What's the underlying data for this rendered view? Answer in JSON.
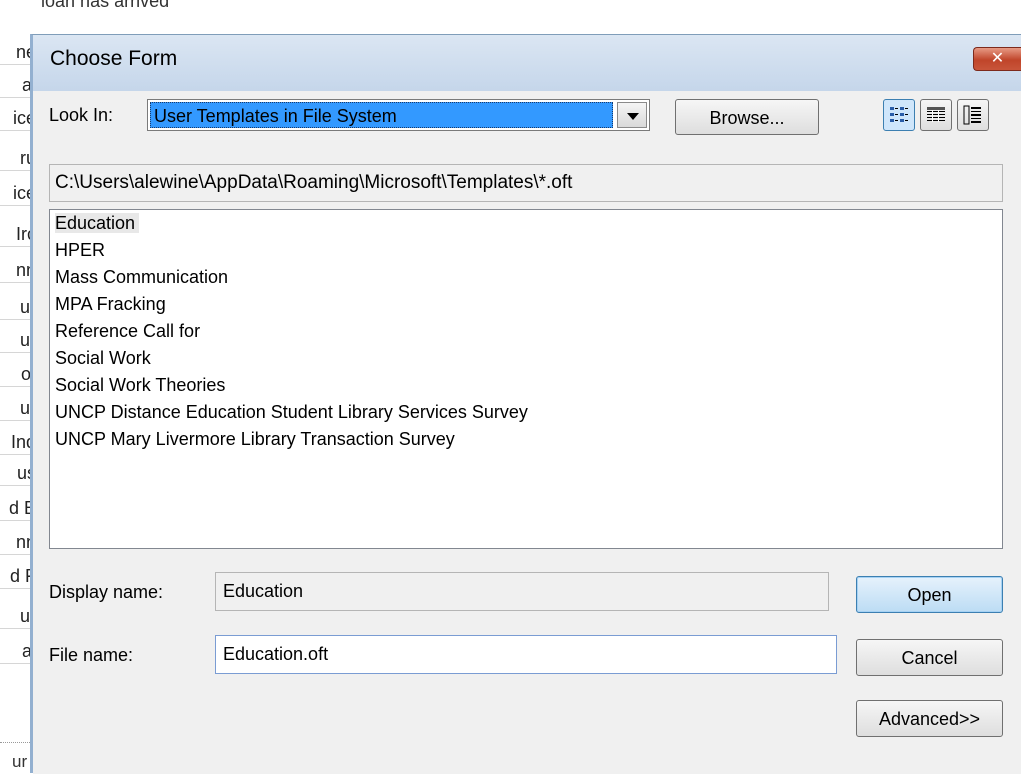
{
  "background": {
    "header_text": "sted loan has arrived",
    "rows": [
      "ne",
      "al",
      "ice",
      "ru",
      "ice",
      "Irc",
      "nn",
      "ur",
      "ur",
      "ot",
      "ur",
      "Ind",
      "us",
      "d E",
      "nn",
      "d F",
      "ur",
      "al"
    ],
    "bottom_text": "ur"
  },
  "dialog": {
    "title": "Choose Form",
    "close_label": "✕",
    "look_in_label": "Look In:",
    "look_in_value": "User Templates in File System",
    "browse_label": "Browse...",
    "view_buttons": [
      "list-view-icon",
      "details-view-icon",
      "properties-view-icon"
    ],
    "path": "C:\\Users\\alewine\\AppData\\Roaming\\Microsoft\\Templates\\*.oft",
    "forms": [
      "Education",
      "HPER",
      "Mass Communication",
      "MPA Fracking",
      "Reference Call for",
      "Social Work",
      "Social Work Theories",
      "UNCP Distance Education Student Library Services Survey",
      "UNCP Mary Livermore Library Transaction Survey"
    ],
    "selected_form": "Education",
    "display_name_label": "Display name:",
    "display_name_value": "Education",
    "file_name_label": "File name:",
    "file_name_value": "Education.oft",
    "open_label": "Open",
    "cancel_label": "Cancel",
    "advanced_label": "Advanced>>"
  },
  "colors": {
    "title_bar": "#c5d6ea",
    "close_button": "#c0452a",
    "selection": "#3399ff"
  }
}
